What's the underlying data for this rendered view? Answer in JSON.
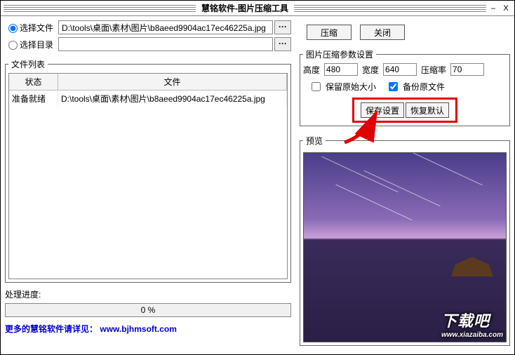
{
  "window": {
    "title": "慧铭软件-图片压缩工具",
    "min": "–",
    "close": "X"
  },
  "selector": {
    "file_radio": "选择文件",
    "dir_radio": "选择目录",
    "file_path": "D:\\tools\\桌面\\素材\\图片\\b8aeed9904ac17ec46225a.jpg",
    "dir_path": "",
    "browse": "···"
  },
  "file_list": {
    "legend": "文件列表",
    "col_status": "状态",
    "col_file": "文件",
    "rows": [
      {
        "status": "准备就绪",
        "file": "D:\\tools\\桌面\\素材\\图片\\b8aeed9904ac17ec46225a.jpg"
      }
    ]
  },
  "progress": {
    "label": "处理进度:",
    "text": "0 %"
  },
  "more": {
    "prefix": "更多的慧铭软件请详见：",
    "link": "www.bjhmsoft.com"
  },
  "actions": {
    "compress": "压缩",
    "close": "关闭"
  },
  "params": {
    "legend": "图片压缩参数设置",
    "height_label": "高度",
    "height": "480",
    "width_label": "宽度",
    "width": "640",
    "ratio_label": "压缩率",
    "ratio": "70",
    "keep_orig": "保留原始大小",
    "backup": "备份原文件",
    "save": "保存设置",
    "restore": "恢复默认"
  },
  "preview": {
    "legend": "预览"
  },
  "watermark": {
    "big": "下载吧",
    "small": "www.xiazaiba.com"
  }
}
